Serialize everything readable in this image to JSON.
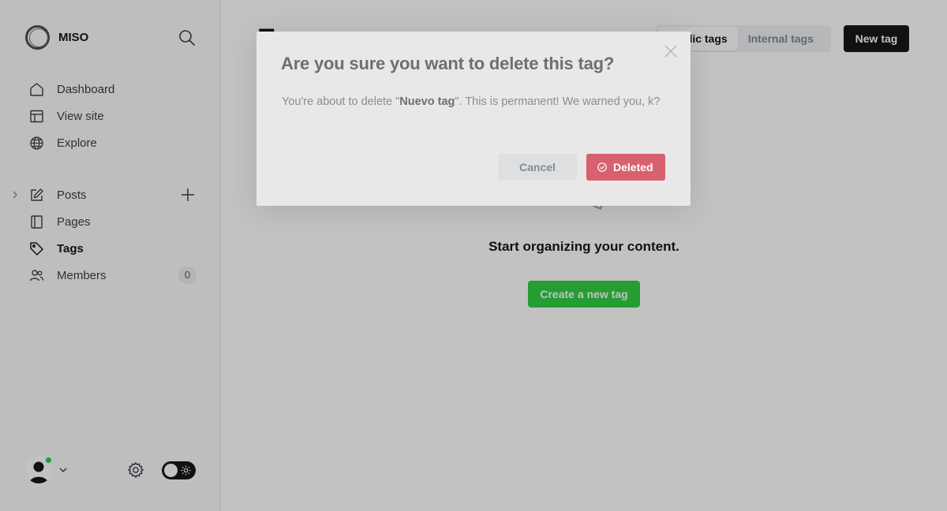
{
  "brand": {
    "name": "MISO"
  },
  "sidebar": {
    "nav_top": [
      {
        "label": "Dashboard",
        "icon": "home-icon"
      },
      {
        "label": "View site",
        "icon": "layout-icon"
      },
      {
        "label": "Explore",
        "icon": "globe-icon"
      }
    ],
    "nav_content": [
      {
        "label": "Posts",
        "icon": "pen-icon"
      },
      {
        "label": "Pages",
        "icon": "page-icon"
      },
      {
        "label": "Tags",
        "icon": "tag-icon",
        "active": true
      },
      {
        "label": "Members",
        "icon": "members-icon",
        "count": "0"
      }
    ]
  },
  "main": {
    "title": "Tags",
    "tabs": [
      {
        "label": "Public tags",
        "active": true
      },
      {
        "label": "Internal tags",
        "active": false
      }
    ],
    "new_tag_label": "New tag",
    "empty_state": {
      "message": "Start organizing your content.",
      "button_label": "Create a new tag"
    }
  },
  "modal": {
    "title": "Are you sure you want to delete this tag?",
    "body_prefix": "You're about to delete \"",
    "tag_name": "Nuevo tag",
    "body_suffix": "\". This is permanent! We warned you, k?",
    "cancel_label": "Cancel",
    "confirm_label": "Deleted"
  },
  "colors": {
    "accent_green": "#30cf43",
    "danger_red": "#d9606f",
    "dark": "#15171a",
    "online": "#30cf43"
  }
}
